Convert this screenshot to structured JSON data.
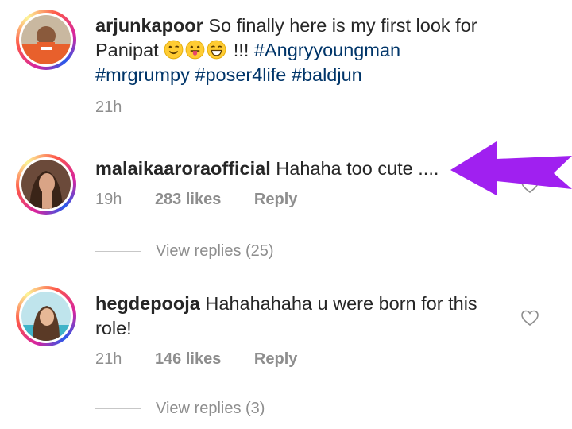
{
  "comments": [
    {
      "username": "arjunkapoor",
      "text_prefix": " So finally here is my first look for Panipat ",
      "emojis": [
        "winking-face",
        "tongue-out-face",
        "grinning-face"
      ],
      "text_suffix": " !!! ",
      "hashtags": [
        "#Angryyoungman",
        "#mrgrumpy",
        "#poser4life",
        "#baldjun"
      ],
      "time": "21h"
    },
    {
      "username": "malaikaaroraofficial",
      "text": " Hahaha too cute ....",
      "time": "19h",
      "likes": "283 likes",
      "reply": "Reply",
      "view_replies": "View replies (25)"
    },
    {
      "username": "hegdepooja",
      "text": " Hahahahaha u were born for this role!",
      "time": "21h",
      "likes": "146 likes",
      "reply": "Reply",
      "view_replies": "View replies (3)"
    }
  ],
  "colors": {
    "arrow": "#a020f0",
    "hashtag": "#003569",
    "meta": "#8e8e8e"
  },
  "icons": [
    "heart-icon",
    "purple-arrow"
  ]
}
